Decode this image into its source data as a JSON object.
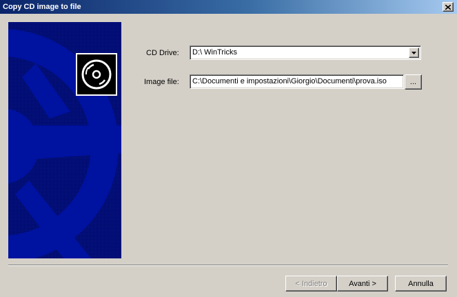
{
  "window": {
    "title": "Copy CD image to file",
    "close_icon": "close-icon"
  },
  "banner": {
    "background_color": "#000a6e",
    "logo_icon": "cd-disc-icon"
  },
  "form": {
    "cd_drive": {
      "label": "CD Drive:",
      "value": "D:\\ WinTricks"
    },
    "image_file": {
      "label": "Image file:",
      "value": "C:\\Documenti e impostazioni\\Giorgio\\Documenti\\prova.iso",
      "browse_label": "..."
    }
  },
  "buttons": {
    "back": {
      "label": "< Indietro",
      "enabled": false
    },
    "next": {
      "label": "Avanti >"
    },
    "cancel": {
      "label": "Annulla"
    }
  }
}
